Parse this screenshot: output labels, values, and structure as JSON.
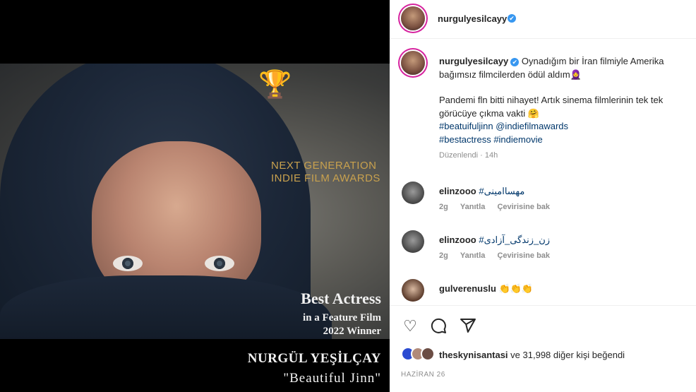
{
  "post": {
    "username": "nurgulyesilcayy",
    "verified_glyph": "✔",
    "image": {
      "award_logo_line1": "NEXT GENERATION",
      "award_logo_line2": "INDIE FILM AWARDS",
      "best_actress": "Best Actress",
      "feature_film": "in a Feature Film",
      "winner_year": "2022 Winner",
      "actress_name": "NURGÜL YEŞİLÇAY",
      "film_title": "\"Beautiful Jinn\""
    },
    "caption": {
      "line1": "Oynadığım bir İran filmiyle Amerika bağımsız filmcilerden ödül aldım",
      "emoji1": "🧕",
      "line2": "Pandemi fln bitti nihayet! Artık sinema filmlerinin tek tek görücüye çıkma vakti",
      "emoji2": "🤗",
      "hashtags_row1": "#beatuifuljinn @indiefilmawards",
      "hashtags_row2": "#bestactress #indiemovie",
      "edited_label": "Düzenlendi",
      "edited_time": "14h"
    },
    "comments": [
      {
        "username": "elinzooo",
        "text": "#مهساامینی",
        "age": "2g",
        "reply": "Yanıtla",
        "translate": "Çevirisine bak"
      },
      {
        "username": "elinzooo",
        "text": "#زن_زندگی_آزادی",
        "age": "2g",
        "reply": "Yanıtla",
        "translate": "Çevirisine bak"
      },
      {
        "username": "gulverenuslu",
        "text": "👏👏👏",
        "age": "",
        "reply": "",
        "translate": ""
      }
    ],
    "actions": {
      "like_icon": "like-icon",
      "comment_icon": "comment-icon",
      "share_icon": "share-icon"
    },
    "likes": {
      "first_liker": "theskynisantasi",
      "rest": "ve 31,998 diğer kişi beğendi"
    },
    "date": "HAZİRAN 26"
  },
  "colors": {
    "hashtag": "#00376b",
    "verified": "#3897f0",
    "award_gold": "#c8a14e"
  }
}
